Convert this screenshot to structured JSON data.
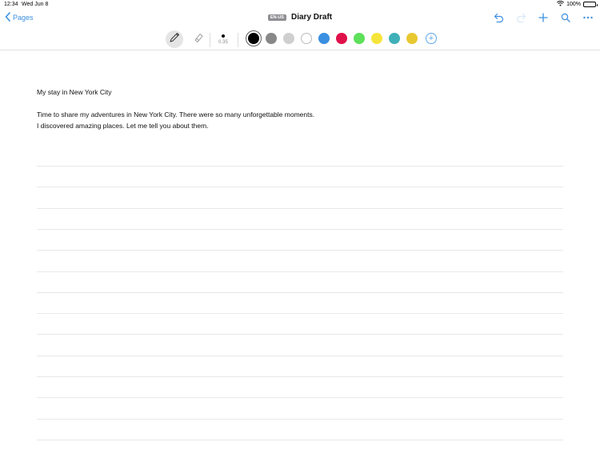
{
  "status": {
    "time": "12:34",
    "date": "Wed Jun 8",
    "battery": "100%",
    "battery_level": 1.0
  },
  "nav": {
    "back_label": "Pages",
    "language_badge": "EN-US",
    "title": "Diary Draft",
    "actions": [
      "undo-icon",
      "redo-icon",
      "add-icon",
      "search-icon",
      "more-icon"
    ]
  },
  "toolbar": {
    "tools": [
      "pencil-icon",
      "eraser-icon"
    ],
    "stroke_size": "0.35",
    "colors": [
      {
        "name": "black",
        "hex": "#000000",
        "selected": true
      },
      {
        "name": "gray",
        "hex": "#888888"
      },
      {
        "name": "light-gray",
        "hex": "#cfcfcf"
      },
      {
        "name": "white",
        "hex": "#ffffff"
      },
      {
        "name": "blue",
        "hex": "#3a8fe0"
      },
      {
        "name": "red",
        "hex": "#e0104a"
      },
      {
        "name": "green",
        "hex": "#5de05a"
      },
      {
        "name": "yellow",
        "hex": "#f5e53a"
      },
      {
        "name": "teal",
        "hex": "#3fb0b8"
      },
      {
        "name": "gold",
        "hex": "#e8c830"
      }
    ]
  },
  "document": {
    "heading": "My stay in New York City",
    "paragraph_lines": [
      "Time to share my adventures in New York City. There were so many unforgettable moments.",
      "I discovered amazing places. Let me tell you about them."
    ]
  }
}
